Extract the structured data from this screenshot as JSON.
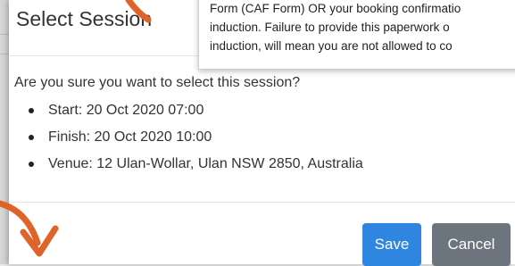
{
  "modal": {
    "title": "Select Session",
    "question": "Are you sure you want to select this session?",
    "details": [
      {
        "label": "Start:",
        "value": "20 Oct 2020 07:00"
      },
      {
        "label": "Finish:",
        "value": "20 Oct 2020 10:00"
      },
      {
        "label": "Venue:",
        "value": "12 Ulan-Wollar, Ulan NSW 2850, Australia"
      }
    ],
    "buttons": {
      "save": "Save",
      "cancel": "Cancel"
    }
  },
  "tooltip": {
    "lines": [
      "Form (CAF Form) OR your booking confirmatio",
      "induction. Failure to provide this paperwork o",
      "induction, will mean you are not allowed to co"
    ]
  },
  "colors": {
    "primary": "#2e86e0",
    "secondary": "#6c757d",
    "annotation_arrow": "#e0632a"
  },
  "icons": [
    "bullet-icon",
    "annotation-arrow-icon"
  ]
}
